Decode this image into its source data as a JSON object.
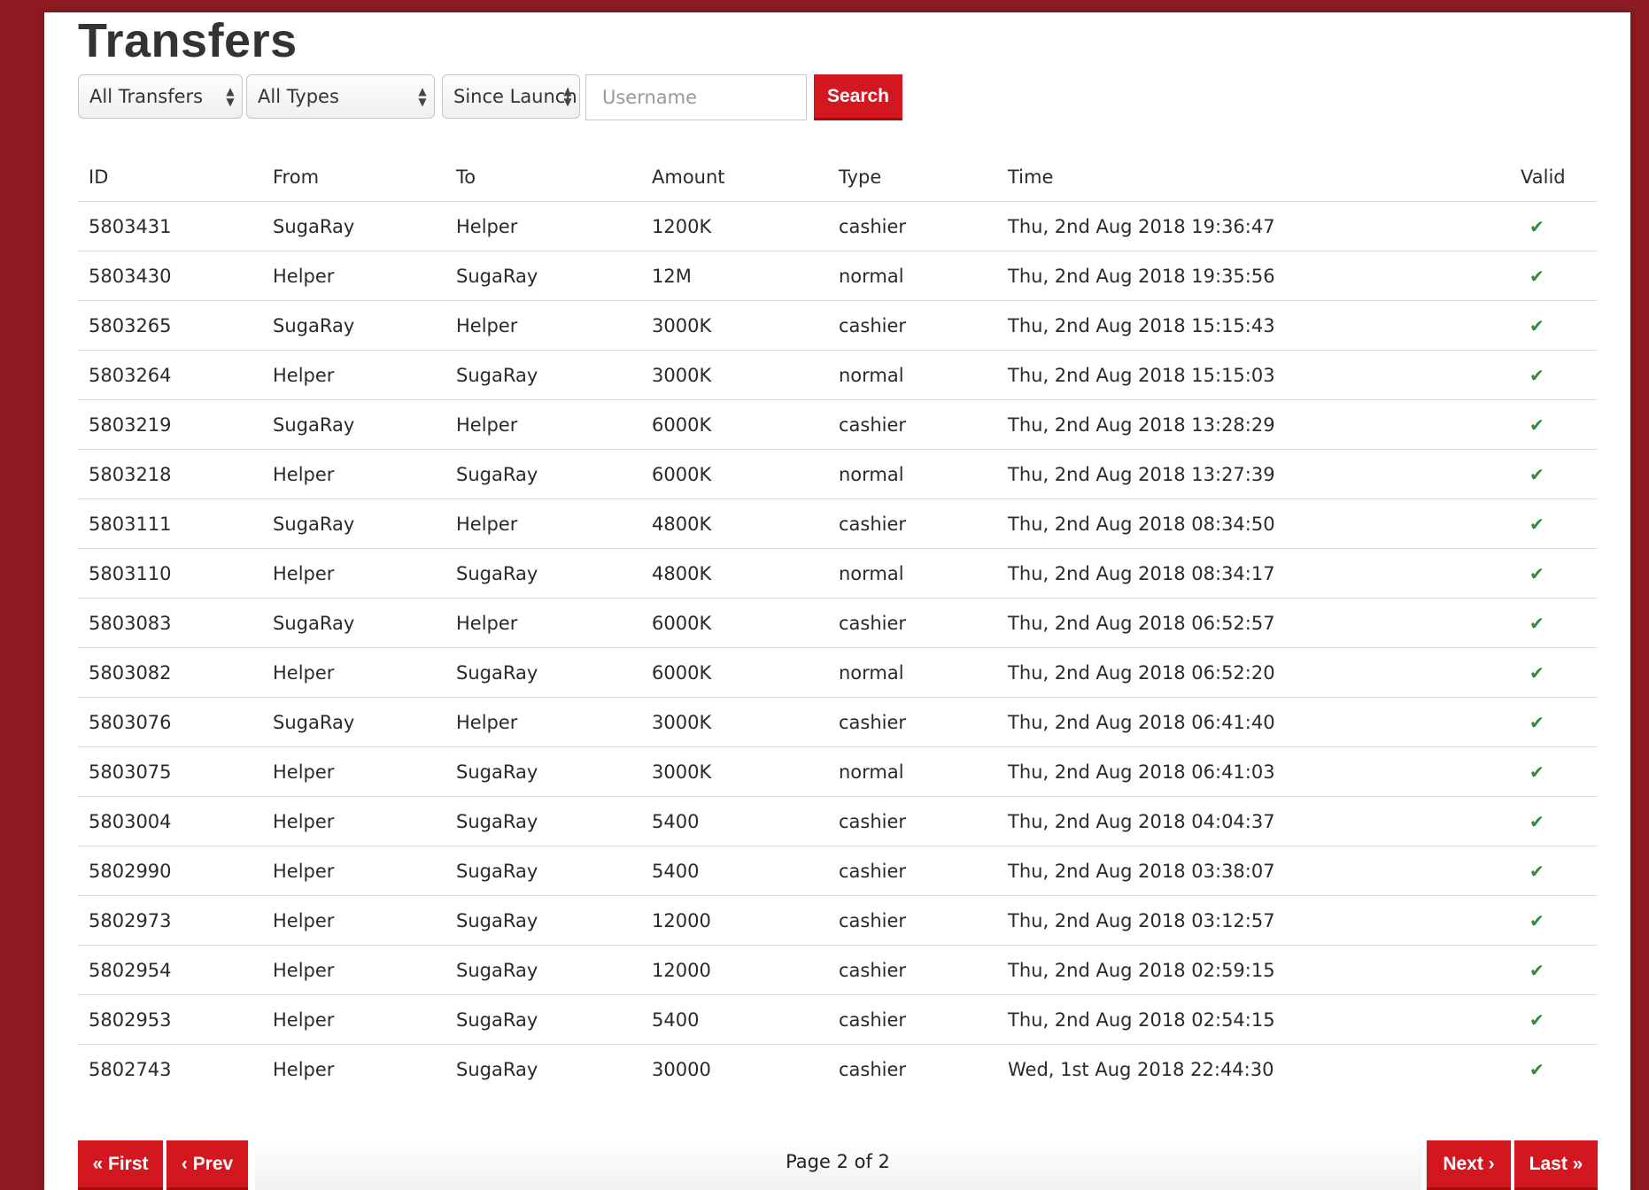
{
  "page_title": "Transfers",
  "filters": {
    "transfers_select": "All Transfers",
    "types_select": "All Types",
    "period_select": "Since Launch",
    "username_placeholder": "Username",
    "search_label": "Search"
  },
  "table": {
    "headers": [
      "ID",
      "From",
      "To",
      "Amount",
      "Type",
      "Time",
      "Valid"
    ],
    "rows": [
      [
        "5803431",
        "SugaRay",
        "Helper",
        "1200K",
        "cashier",
        "Thu, 2nd Aug 2018 19:36:47"
      ],
      [
        "5803430",
        "Helper",
        "SugaRay",
        "12M",
        "normal",
        "Thu, 2nd Aug 2018 19:35:56"
      ],
      [
        "5803265",
        "SugaRay",
        "Helper",
        "3000K",
        "cashier",
        "Thu, 2nd Aug 2018 15:15:43"
      ],
      [
        "5803264",
        "Helper",
        "SugaRay",
        "3000K",
        "normal",
        "Thu, 2nd Aug 2018 15:15:03"
      ],
      [
        "5803219",
        "SugaRay",
        "Helper",
        "6000K",
        "cashier",
        "Thu, 2nd Aug 2018 13:28:29"
      ],
      [
        "5803218",
        "Helper",
        "SugaRay",
        "6000K",
        "normal",
        "Thu, 2nd Aug 2018 13:27:39"
      ],
      [
        "5803111",
        "SugaRay",
        "Helper",
        "4800K",
        "cashier",
        "Thu, 2nd Aug 2018 08:34:50"
      ],
      [
        "5803110",
        "Helper",
        "SugaRay",
        "4800K",
        "normal",
        "Thu, 2nd Aug 2018 08:34:17"
      ],
      [
        "5803083",
        "SugaRay",
        "Helper",
        "6000K",
        "cashier",
        "Thu, 2nd Aug 2018 06:52:57"
      ],
      [
        "5803082",
        "Helper",
        "SugaRay",
        "6000K",
        "normal",
        "Thu, 2nd Aug 2018 06:52:20"
      ],
      [
        "5803076",
        "SugaRay",
        "Helper",
        "3000K",
        "cashier",
        "Thu, 2nd Aug 2018 06:41:40"
      ],
      [
        "5803075",
        "Helper",
        "SugaRay",
        "3000K",
        "normal",
        "Thu, 2nd Aug 2018 06:41:03"
      ],
      [
        "5803004",
        "Helper",
        "SugaRay",
        "5400",
        "cashier",
        "Thu, 2nd Aug 2018 04:04:37"
      ],
      [
        "5802990",
        "Helper",
        "SugaRay",
        "5400",
        "cashier",
        "Thu, 2nd Aug 2018 03:38:07"
      ],
      [
        "5802973",
        "Helper",
        "SugaRay",
        "12000",
        "cashier",
        "Thu, 2nd Aug 2018 03:12:57"
      ],
      [
        "5802954",
        "Helper",
        "SugaRay",
        "12000",
        "cashier",
        "Thu, 2nd Aug 2018 02:59:15"
      ],
      [
        "5802953",
        "Helper",
        "SugaRay",
        "5400",
        "cashier",
        "Thu, 2nd Aug 2018 02:54:15"
      ],
      [
        "5802743",
        "Helper",
        "SugaRay",
        "30000",
        "cashier",
        "Wed, 1st Aug 2018 22:44:30"
      ]
    ],
    "valid_icon": "check-icon",
    "valid_color": "#2e8b3a"
  },
  "pagination": {
    "first_label": "« First",
    "prev_label": "‹ Prev",
    "page_info": "Page 2 of 2",
    "next_label": "Next ›",
    "last_label": "Last »"
  },
  "colors": {
    "accent": "#d2171f",
    "background": "#8e1b22"
  }
}
